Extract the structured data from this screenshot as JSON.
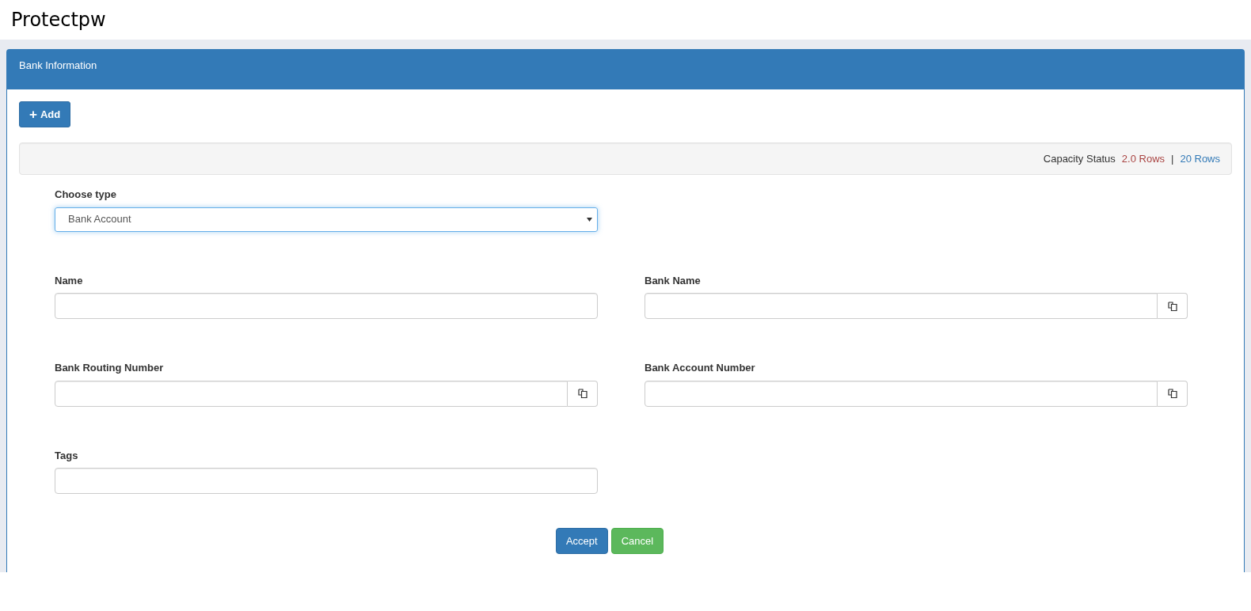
{
  "app_title": "Protectpw",
  "panel": {
    "title": "Bank Information"
  },
  "add_button": {
    "icon": "+",
    "label": "Add"
  },
  "capacity": {
    "label": "Capacity Status",
    "used": "2.0 Rows",
    "separator": "|",
    "total": "20 Rows"
  },
  "type_select": {
    "label": "Choose type",
    "value": "Bank Account",
    "focused": true
  },
  "fields": [
    {
      "label": "Name",
      "kind": "text"
    },
    {
      "label": "Bank Name",
      "kind": "copy"
    },
    {
      "label": "Bank Routing Number",
      "kind": "copy"
    },
    {
      "label": "Bank Account Number",
      "kind": "copy"
    },
    {
      "label": "Tags",
      "kind": "text"
    }
  ],
  "buttons": [
    {
      "label": "Accept",
      "kind": "primary"
    },
    {
      "label": "Cancel",
      "kind": "success"
    }
  ]
}
